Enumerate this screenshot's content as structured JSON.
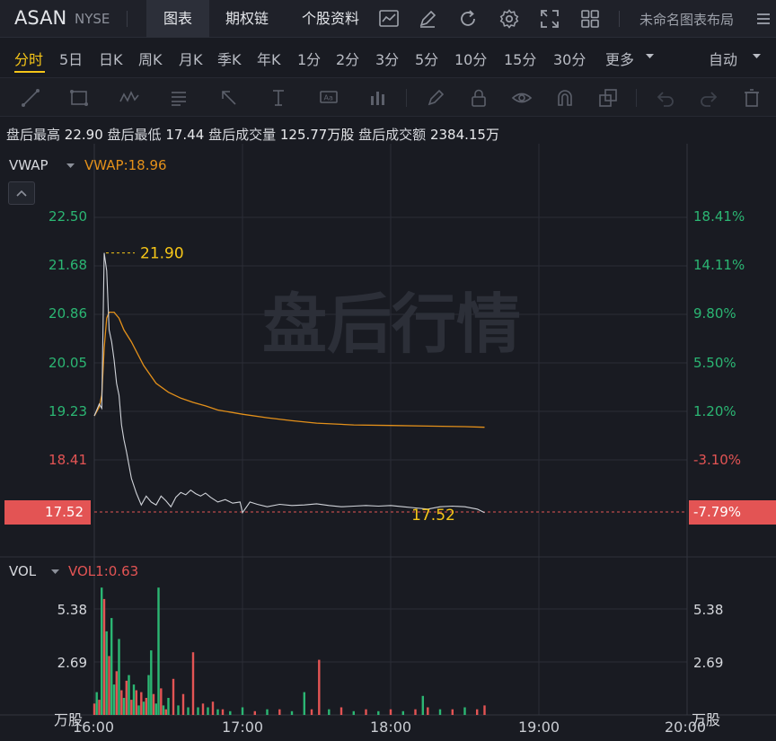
{
  "header": {
    "symbol": "ASAN",
    "exchange": "NYSE",
    "tabs": [
      "图表",
      "期权链",
      "个股资料"
    ],
    "active_tab": "图表",
    "layout_name": "未命名图表布局",
    "icons": [
      "line-chart-icon",
      "pen-icon",
      "refresh-icon",
      "settings-icon",
      "fullscreen-icon",
      "grid-layout-icon",
      "menu-icon"
    ]
  },
  "periods": {
    "items": [
      "分时",
      "5日",
      "日K",
      "周K",
      "月K",
      "季K",
      "年K",
      "1分",
      "2分",
      "3分",
      "5分",
      "10分",
      "15分",
      "30分",
      "更多"
    ],
    "active": "分时",
    "mode": "自动"
  },
  "tools": [
    "trend-line-icon",
    "rectangle-icon",
    "pattern-icon",
    "fib-icon",
    "arrow-icon",
    "text-cursor-icon",
    "annotation-icon",
    "bars-icon",
    "brush-icon",
    "lock-icon",
    "eye-icon",
    "magnet-icon",
    "layers-icon",
    "undo-icon",
    "redo-icon",
    "trash-icon"
  ],
  "stats": {
    "high_label": "盘后最高",
    "high": "22.90",
    "low_label": "盘后最低",
    "low": "17.44",
    "vol_label": "盘后成交量",
    "vol": "125.77万股",
    "amt_label": "盘后成交额",
    "amt": "2384.15万"
  },
  "price_panel": {
    "indicator": "VWAP",
    "indicator_value": "VWAP:18.96",
    "watermark": "盘后行情",
    "left_axis": [
      "22.50",
      "21.68",
      "20.86",
      "20.05",
      "19.23",
      "18.41"
    ],
    "right_axis": [
      "18.41%",
      "14.11%",
      "9.80%",
      "5.50%",
      "1.20%",
      "-3.10%"
    ],
    "current_price": "17.52",
    "current_pct": "-7.79%",
    "peak_label": "21.90",
    "last_label": "17.52"
  },
  "volume_panel": {
    "indicator": "VOL",
    "indicator_value": "VOL1:0.63",
    "axis": [
      "5.38",
      "2.69"
    ],
    "unit": "万股"
  },
  "x_axis": [
    "16:00",
    "17:00",
    "18:00",
    "19:00",
    "20:00"
  ],
  "colors": {
    "price_line": "#d0d3d9",
    "vwap_line": "#e3901a",
    "up": "#2bb673",
    "down": "#e35454",
    "accent": "#f5c518"
  },
  "chart_data": {
    "type": "line",
    "series": [
      {
        "name": "",
        "x": [
          "16:00",
          "16:02",
          "16:03",
          "16:04",
          "16:05",
          "16:06",
          "16:07",
          "16:08",
          "16:09",
          "16:10",
          "16:11",
          "16:12",
          "16:13",
          "16:15",
          "16:17",
          "16:19",
          "16:21",
          "16:23",
          "16:25",
          "16:27",
          "16:29",
          "16:31",
          "16:33",
          "16:35",
          "16:37",
          "16:39",
          "16:41",
          "16:43",
          "16:45",
          "16:47",
          "16:50",
          "16:53",
          "16:56",
          "16:59",
          "17:00",
          "17:03",
          "17:06",
          "17:10",
          "17:15",
          "17:20",
          "17:25",
          "17:30",
          "17:35",
          "17:40",
          "17:45",
          "17:50",
          "17:55",
          "18:00",
          "18:05",
          "18:10",
          "18:15",
          "18:20",
          "18:25",
          "18:30",
          "18:35",
          "18:38"
        ],
        "values": [
          19.15,
          19.35,
          19.28,
          21.9,
          21.6,
          20.6,
          20.4,
          20.1,
          19.7,
          19.5,
          19.0,
          18.75,
          18.55,
          18.1,
          17.85,
          17.65,
          17.8,
          17.7,
          17.65,
          17.8,
          17.72,
          17.62,
          17.78,
          17.86,
          17.82,
          17.9,
          17.84,
          17.8,
          17.85,
          17.78,
          17.7,
          17.74,
          17.68,
          17.7,
          17.52,
          17.7,
          17.66,
          17.62,
          17.66,
          17.64,
          17.65,
          17.67,
          17.64,
          17.62,
          17.63,
          17.64,
          17.63,
          17.64,
          17.62,
          17.6,
          17.58,
          17.62,
          17.63,
          17.62,
          17.58,
          17.52
        ]
      },
      {
        "name": "VWAP",
        "x": [
          "16:00",
          "16:02",
          "16:03",
          "16:04",
          "16:05",
          "16:06",
          "16:08",
          "16:10",
          "16:12",
          "16:15",
          "16:20",
          "16:25",
          "16:30",
          "16:35",
          "16:40",
          "16:45",
          "16:50",
          "17:00",
          "17:10",
          "17:20",
          "17:30",
          "17:45",
          "18:00",
          "18:15",
          "18:30",
          "18:38"
        ],
        "values": [
          19.15,
          19.3,
          19.5,
          20.3,
          20.8,
          20.9,
          20.9,
          20.8,
          20.6,
          20.4,
          20.0,
          19.7,
          19.55,
          19.45,
          19.38,
          19.32,
          19.25,
          19.18,
          19.12,
          19.07,
          19.03,
          19.0,
          18.99,
          18.98,
          18.97,
          18.96
        ]
      }
    ],
    "volume": {
      "x": [
        "16:00",
        "16:01",
        "16:02",
        "16:03",
        "16:04",
        "16:05",
        "16:06",
        "16:07",
        "16:08",
        "16:09",
        "16:10",
        "16:11",
        "16:12",
        "16:13",
        "16:14",
        "16:15",
        "16:16",
        "16:17",
        "16:18",
        "16:19",
        "16:20",
        "16:21",
        "16:22",
        "16:23",
        "16:24",
        "16:25",
        "16:26",
        "16:27",
        "16:28",
        "16:29",
        "16:30",
        "16:32",
        "16:34",
        "16:36",
        "16:38",
        "16:40",
        "16:42",
        "16:44",
        "16:46",
        "16:48",
        "16:50",
        "16:52",
        "16:55",
        "17:00",
        "17:05",
        "17:10",
        "17:15",
        "17:20",
        "17:25",
        "17:28",
        "17:31",
        "17:35",
        "17:40",
        "17:45",
        "17:50",
        "17:55",
        "18:00",
        "18:05",
        "18:10",
        "18:13",
        "18:15",
        "18:20",
        "18:25",
        "18:30",
        "18:35",
        "18:38"
      ],
      "values": [
        0.6,
        1.2,
        0.8,
        6.7,
        6.1,
        4.4,
        3.1,
        5.1,
        1.6,
        2.3,
        4.0,
        1.3,
        0.9,
        1.8,
        2.1,
        0.8,
        1.6,
        1.3,
        0.5,
        1.2,
        0.7,
        0.9,
        2.1,
        3.4,
        1.1,
        0.6,
        6.7,
        1.4,
        0.5,
        0.3,
        0.9,
        1.9,
        0.5,
        1.1,
        0.4,
        3.3,
        0.4,
        0.6,
        0.4,
        0.7,
        0.3,
        0.3,
        0.2,
        0.4,
        0.2,
        0.3,
        0.3,
        0.2,
        1.2,
        0.3,
        2.9,
        0.3,
        0.4,
        0.2,
        0.3,
        0.2,
        0.3,
        0.2,
        0.3,
        1.0,
        0.4,
        0.3,
        0.3,
        0.4,
        0.3,
        0.5
      ],
      "up": [
        false,
        true,
        false,
        true,
        false,
        true,
        false,
        true,
        true,
        false,
        true,
        false,
        true,
        false,
        true,
        false,
        true,
        false,
        true,
        false,
        true,
        false,
        true,
        true,
        false,
        true,
        true,
        false,
        true,
        false,
        true,
        false,
        true,
        false,
        true,
        false,
        true,
        false,
        true,
        false,
        true,
        false,
        true,
        true,
        false,
        true,
        false,
        true,
        true,
        false,
        false,
        true,
        false,
        true,
        false,
        true,
        false,
        true,
        false,
        true,
        false,
        true,
        false,
        true,
        false,
        false
      ]
    },
    "xlabel": "",
    "ylabel": "",
    "ylim": [
      17.25,
      22.75
    ],
    "x_range": [
      "16:00",
      "20:00"
    ],
    "volume_ylim": [
      0,
      6.9
    ],
    "grid": true
  }
}
